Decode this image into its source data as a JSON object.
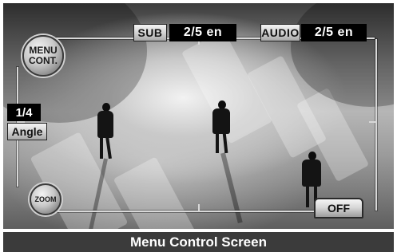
{
  "screen": {
    "menu_cont_line1": "MENU",
    "menu_cont_line2": "CONT.",
    "subtitle": {
      "label": "SUB",
      "value": "2/5 en"
    },
    "audio": {
      "label": "AUDIO",
      "value": "2/5 en"
    },
    "angle": {
      "value": "1/4",
      "label": "Angle"
    },
    "zoom_label": "ZOOM",
    "off_label": "OFF"
  },
  "caption": "Menu Control Screen"
}
